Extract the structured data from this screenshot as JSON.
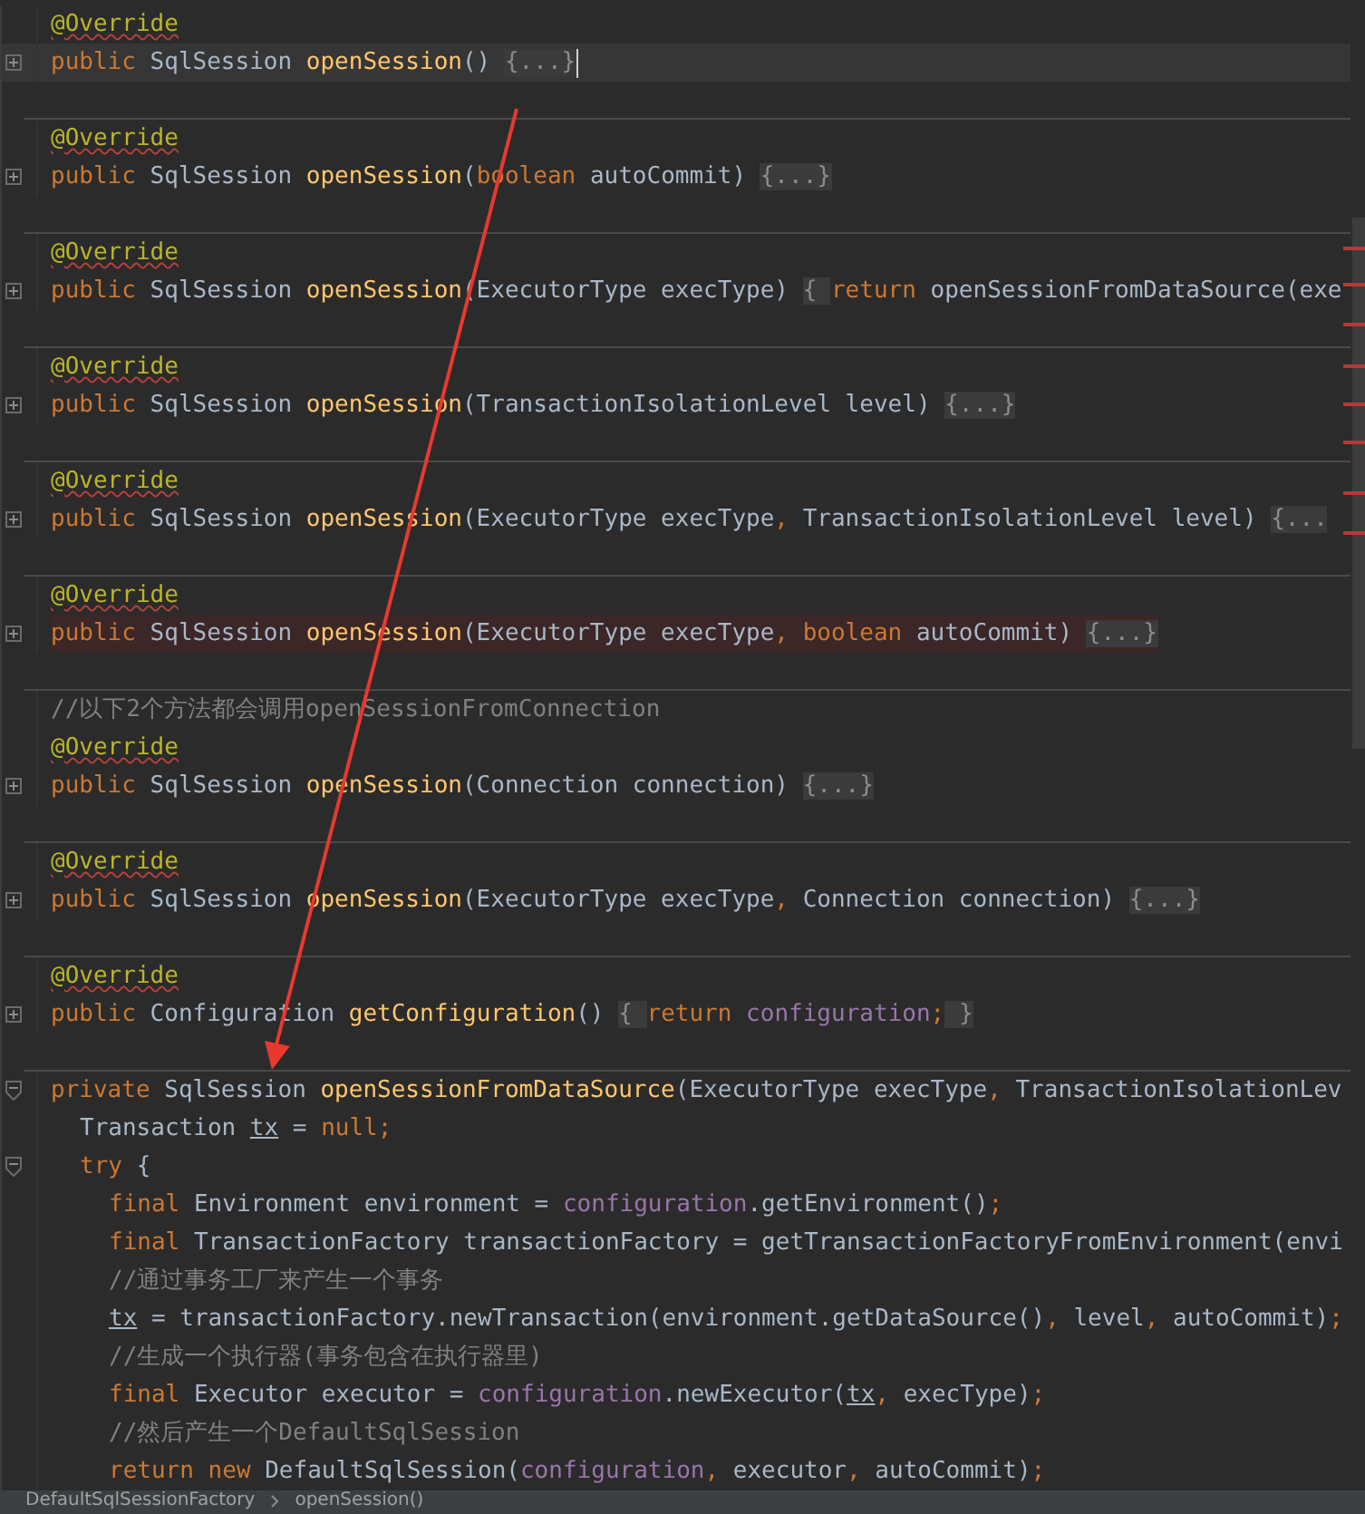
{
  "editor": {
    "lines": [
      {
        "kind": "code",
        "foldable": false,
        "current": false,
        "error": false,
        "tokens": [
          {
            "kind": "ann",
            "text": "@Override"
          }
        ]
      },
      {
        "kind": "code",
        "foldable": true,
        "collapsed": true,
        "current": true,
        "error": false,
        "tokens": [
          {
            "kind": "kw",
            "text": "public "
          },
          {
            "kind": "txt",
            "text": "SqlSession "
          },
          {
            "kind": "fn",
            "text": "openSession"
          },
          {
            "kind": "txt",
            "text": "() "
          },
          {
            "kind": "fold",
            "text": "{...}"
          }
        ]
      },
      {
        "kind": "separator"
      },
      {
        "kind": "code",
        "foldable": false,
        "current": false,
        "error": false,
        "tokens": [
          {
            "kind": "ann",
            "text": "@Override"
          }
        ]
      },
      {
        "kind": "code",
        "foldable": true,
        "collapsed": true,
        "current": false,
        "error": false,
        "tokens": [
          {
            "kind": "kw",
            "text": "public "
          },
          {
            "kind": "txt",
            "text": "SqlSession "
          },
          {
            "kind": "fn",
            "text": "openSession"
          },
          {
            "kind": "txt",
            "text": "("
          },
          {
            "kind": "kw",
            "text": "boolean "
          },
          {
            "kind": "txt",
            "text": "autoCommit) "
          },
          {
            "kind": "fold",
            "text": "{...}"
          }
        ]
      },
      {
        "kind": "separator"
      },
      {
        "kind": "code",
        "foldable": false,
        "current": false,
        "error": false,
        "tokens": [
          {
            "kind": "ann",
            "text": "@Override"
          }
        ]
      },
      {
        "kind": "code",
        "foldable": true,
        "collapsed": true,
        "current": false,
        "error": false,
        "tokens": [
          {
            "kind": "kw",
            "text": "public "
          },
          {
            "kind": "txt",
            "text": "SqlSession "
          },
          {
            "kind": "fn",
            "text": "openSession"
          },
          {
            "kind": "txt",
            "text": "(ExecutorType execType) "
          },
          {
            "kind": "fold",
            "text": "{ "
          },
          {
            "kind": "kw",
            "text": "return "
          },
          {
            "kind": "txt",
            "text": "openSessionFromDataSource(exe"
          }
        ]
      },
      {
        "kind": "separator"
      },
      {
        "kind": "code",
        "foldable": false,
        "current": false,
        "error": false,
        "tokens": [
          {
            "kind": "ann",
            "text": "@Override"
          }
        ]
      },
      {
        "kind": "code",
        "foldable": true,
        "collapsed": true,
        "current": false,
        "error": false,
        "tokens": [
          {
            "kind": "kw",
            "text": "public "
          },
          {
            "kind": "txt",
            "text": "SqlSession "
          },
          {
            "kind": "fn",
            "text": "openSession"
          },
          {
            "kind": "txt",
            "text": "(TransactionIsolationLevel level) "
          },
          {
            "kind": "fold",
            "text": "{...}"
          }
        ]
      },
      {
        "kind": "separator"
      },
      {
        "kind": "code",
        "foldable": false,
        "current": false,
        "error": false,
        "tokens": [
          {
            "kind": "ann",
            "text": "@Override"
          }
        ]
      },
      {
        "kind": "code",
        "foldable": true,
        "collapsed": true,
        "current": false,
        "error": false,
        "tokens": [
          {
            "kind": "kw",
            "text": "public "
          },
          {
            "kind": "txt",
            "text": "SqlSession "
          },
          {
            "kind": "fn",
            "text": "openSession"
          },
          {
            "kind": "txt",
            "text": "(ExecutorType execType"
          },
          {
            "kind": "pun",
            "text": ", "
          },
          {
            "kind": "txt",
            "text": "TransactionIsolationLevel level) "
          },
          {
            "kind": "fold",
            "text": "{..."
          }
        ]
      },
      {
        "kind": "separator"
      },
      {
        "kind": "code",
        "foldable": false,
        "current": false,
        "error": false,
        "tokens": [
          {
            "kind": "ann",
            "text": "@Override"
          }
        ]
      },
      {
        "kind": "code",
        "foldable": true,
        "collapsed": true,
        "current": false,
        "error": true,
        "tokens": [
          {
            "kind": "kw",
            "text": "public "
          },
          {
            "kind": "txt",
            "text": "SqlSession "
          },
          {
            "kind": "fn",
            "text": "openSession"
          },
          {
            "kind": "txt",
            "text": "(ExecutorType execType"
          },
          {
            "kind": "pun",
            "text": ", "
          },
          {
            "kind": "kw",
            "text": "boolean "
          },
          {
            "kind": "txt",
            "text": "autoCommit) "
          },
          {
            "kind": "fold",
            "text": "{...}"
          }
        ]
      },
      {
        "kind": "separator"
      },
      {
        "kind": "code",
        "foldable": false,
        "current": false,
        "error": false,
        "tokens": [
          {
            "kind": "cmt",
            "text": "//以下2个方法都会调用openSessionFromConnection"
          }
        ]
      },
      {
        "kind": "code",
        "foldable": false,
        "current": false,
        "error": false,
        "tokens": [
          {
            "kind": "ann",
            "text": "@Override"
          }
        ]
      },
      {
        "kind": "code",
        "foldable": true,
        "collapsed": true,
        "current": false,
        "error": false,
        "tokens": [
          {
            "kind": "kw",
            "text": "public "
          },
          {
            "kind": "txt",
            "text": "SqlSession "
          },
          {
            "kind": "fn",
            "text": "openSession"
          },
          {
            "kind": "txt",
            "text": "(Connection connection) "
          },
          {
            "kind": "fold",
            "text": "{...}"
          }
        ]
      },
      {
        "kind": "separator"
      },
      {
        "kind": "code",
        "foldable": false,
        "current": false,
        "error": false,
        "tokens": [
          {
            "kind": "ann",
            "text": "@Override"
          }
        ]
      },
      {
        "kind": "code",
        "foldable": true,
        "collapsed": true,
        "current": false,
        "error": false,
        "tokens": [
          {
            "kind": "kw",
            "text": "public "
          },
          {
            "kind": "txt",
            "text": "SqlSession "
          },
          {
            "kind": "fn",
            "text": "openSession"
          },
          {
            "kind": "txt",
            "text": "(ExecutorType execType"
          },
          {
            "kind": "pun",
            "text": ", "
          },
          {
            "kind": "txt",
            "text": "Connection connection) "
          },
          {
            "kind": "fold",
            "text": "{...}"
          }
        ]
      },
      {
        "kind": "separator"
      },
      {
        "kind": "code",
        "foldable": false,
        "current": false,
        "error": false,
        "tokens": [
          {
            "kind": "ann",
            "text": "@Override"
          }
        ]
      },
      {
        "kind": "code",
        "foldable": true,
        "collapsed": true,
        "current": false,
        "error": false,
        "tokens": [
          {
            "kind": "kw",
            "text": "public "
          },
          {
            "kind": "txt",
            "text": "Configuration "
          },
          {
            "kind": "fn",
            "text": "getConfiguration"
          },
          {
            "kind": "txt",
            "text": "() "
          },
          {
            "kind": "fold",
            "text": "{ "
          },
          {
            "kind": "kw",
            "text": "return "
          },
          {
            "kind": "fld",
            "text": "configuration"
          },
          {
            "kind": "pun",
            "text": ";"
          },
          {
            "kind": "fold",
            "text": " }"
          }
        ]
      },
      {
        "kind": "separator"
      },
      {
        "kind": "code",
        "foldable": true,
        "collapsed": false,
        "current": false,
        "error": false,
        "tokens": [
          {
            "kind": "kw",
            "text": "private "
          },
          {
            "kind": "txt",
            "text": "SqlSession "
          },
          {
            "kind": "fn",
            "text": "openSessionFromDataSource"
          },
          {
            "kind": "txt",
            "text": "(ExecutorType execType"
          },
          {
            "kind": "pun",
            "text": ", "
          },
          {
            "kind": "txt",
            "text": "TransactionIsolationLev"
          }
        ],
        "children": [
          {
            "kind": "code",
            "foldable": false,
            "current": false,
            "error": false,
            "tokens": [
              {
                "kind": "txt",
                "text": "Transaction "
              },
              {
                "kind": "loc",
                "text": "tx"
              },
              {
                "kind": "txt",
                "text": " = "
              },
              {
                "kind": "kw",
                "text": "null"
              },
              {
                "kind": "pun",
                "text": ";"
              }
            ]
          },
          {
            "kind": "code",
            "foldable": true,
            "collapsed": false,
            "current": false,
            "error": false,
            "tokens": [
              {
                "kind": "kw",
                "text": "try "
              },
              {
                "kind": "txt",
                "text": "{"
              }
            ],
            "children": [
              {
                "kind": "code",
                "foldable": false,
                "current": false,
                "error": false,
                "tokens": [
                  {
                    "kind": "kw",
                    "text": "final "
                  },
                  {
                    "kind": "txt",
                    "text": "Environment environment = "
                  },
                  {
                    "kind": "fld",
                    "text": "configuration"
                  },
                  {
                    "kind": "txt",
                    "text": ".getEnvironment()"
                  },
                  {
                    "kind": "pun",
                    "text": ";"
                  }
                ]
              },
              {
                "kind": "code",
                "foldable": false,
                "current": false,
                "error": false,
                "tokens": [
                  {
                    "kind": "kw",
                    "text": "final "
                  },
                  {
                    "kind": "txt",
                    "text": "TransactionFactory transactionFactory = getTransactionFactoryFromEnvironment(envi"
                  }
                ]
              },
              {
                "kind": "code",
                "foldable": false,
                "current": false,
                "error": false,
                "tokens": [
                  {
                    "kind": "cmt",
                    "text": "//通过事务工厂来产生一个事务"
                  }
                ]
              },
              {
                "kind": "code",
                "foldable": false,
                "current": false,
                "error": false,
                "tokens": [
                  {
                    "kind": "loc",
                    "text": "tx"
                  },
                  {
                    "kind": "txt",
                    "text": " = transactionFactory.newTransaction(environment.getDataSource()"
                  },
                  {
                    "kind": "pun",
                    "text": ", "
                  },
                  {
                    "kind": "txt",
                    "text": "level"
                  },
                  {
                    "kind": "pun",
                    "text": ", "
                  },
                  {
                    "kind": "txt",
                    "text": "autoCommit)"
                  },
                  {
                    "kind": "pun",
                    "text": ";"
                  }
                ]
              },
              {
                "kind": "code",
                "foldable": false,
                "current": false,
                "error": false,
                "tokens": [
                  {
                    "kind": "cmt",
                    "text": "//生成一个执行器(事务包含在执行器里)"
                  }
                ]
              },
              {
                "kind": "code",
                "foldable": false,
                "current": false,
                "error": false,
                "tokens": [
                  {
                    "kind": "kw",
                    "text": "final "
                  },
                  {
                    "kind": "txt",
                    "text": "Executor executor = "
                  },
                  {
                    "kind": "fld",
                    "text": "configuration"
                  },
                  {
                    "kind": "txt",
                    "text": ".newExecutor("
                  },
                  {
                    "kind": "loc",
                    "text": "tx"
                  },
                  {
                    "kind": "pun",
                    "text": ", "
                  },
                  {
                    "kind": "txt",
                    "text": "execType)"
                  },
                  {
                    "kind": "pun",
                    "text": ";"
                  }
                ]
              },
              {
                "kind": "code",
                "foldable": false,
                "current": false,
                "error": false,
                "tokens": [
                  {
                    "kind": "cmt",
                    "text": "//然后产生一个DefaultSqlSession"
                  }
                ]
              },
              {
                "kind": "code",
                "foldable": false,
                "current": false,
                "error": false,
                "tokens": [
                  {
                    "kind": "kw",
                    "text": "return new "
                  },
                  {
                    "kind": "txt",
                    "text": "DefaultSqlSession("
                  },
                  {
                    "kind": "fld",
                    "text": "configuration"
                  },
                  {
                    "kind": "pun",
                    "text": ", "
                  },
                  {
                    "kind": "txt",
                    "text": "executor"
                  },
                  {
                    "kind": "pun",
                    "text": ", "
                  },
                  {
                    "kind": "txt",
                    "text": "autoCommit)"
                  },
                  {
                    "kind": "pun",
                    "text": ";"
                  }
                ]
              }
            ]
          }
        ]
      }
    ]
  },
  "breadcrumb": [
    "DefaultSqlSessionFactory",
    "openSession()"
  ]
}
